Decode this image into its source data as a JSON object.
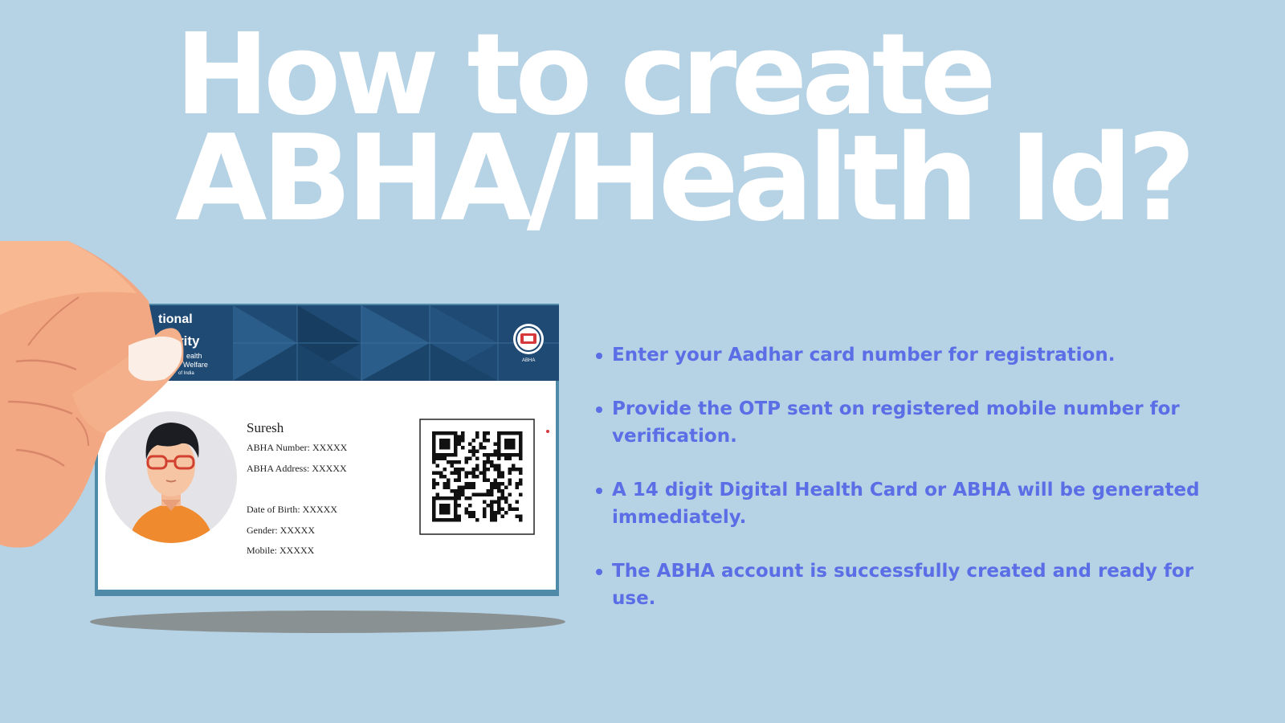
{
  "headline": {
    "line1": "How to create",
    "line2": "ABHA/Health Id?"
  },
  "card": {
    "header_fragments": [
      "tional",
      "rity",
      "ealth",
      "Welfare",
      "of India"
    ],
    "logo_caption": "ABHA",
    "name": "Suresh",
    "abha_number": "ABHA Number: XXXXX",
    "abha_address": "ABHA Address: XXXXX",
    "dob": "Date of Birth: XXXXX",
    "gender": "Gender: XXXXX",
    "mobile": "Mobile: XXXXX"
  },
  "steps": [
    "Enter your Aadhar card number for registration.",
    "Provide the OTP sent on registered mobile number for verification.",
    "A 14 digit Digital Health Card or ABHA will be generated immediately.",
    "The ABHA account is successfully created and ready for use."
  ],
  "icons": [
    "hand-icon",
    "avatar-icon",
    "qr-code-icon",
    "abha-logo-icon",
    "emblem-icon"
  ],
  "colors": {
    "background": "#b6d2e5",
    "headline": "#ffffff",
    "steps_text": "#5b6ee6",
    "card_header": "#1f4a73",
    "avatar_shirt": "#f08a2e"
  }
}
